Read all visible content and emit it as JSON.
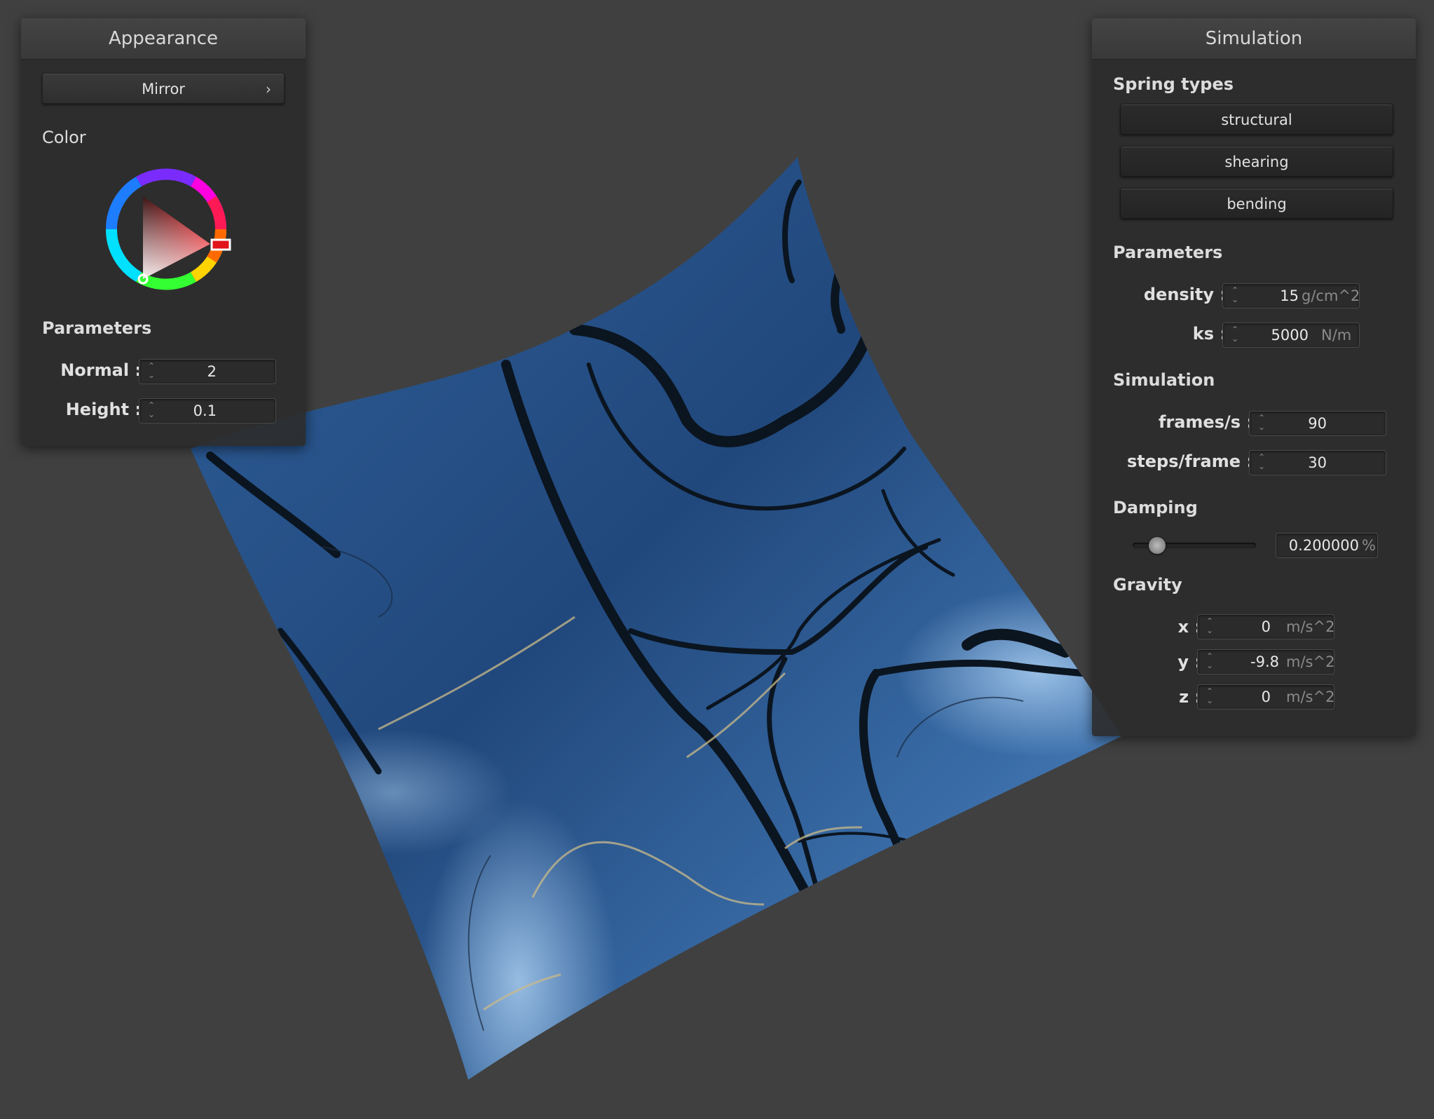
{
  "appearance": {
    "title": "Appearance",
    "shader_button": "Mirror",
    "color_label": "Color",
    "parameters_label": "Parameters",
    "normal_label": "Normal :",
    "normal_value": "2",
    "height_label": "Height :",
    "height_value": "0.1"
  },
  "simulation": {
    "title": "Simulation",
    "spring_types_label": "Spring types",
    "spring_buttons": [
      "structural",
      "shearing",
      "bending"
    ],
    "parameters_label": "Parameters",
    "density_label": "density :",
    "density_value": "15",
    "density_unit": "g/cm^2",
    "ks_label": "ks :",
    "ks_value": "5000",
    "ks_unit": "N/m",
    "simulation_label": "Simulation",
    "fps_label": "frames/s :",
    "fps_value": "90",
    "steps_label": "steps/frame :",
    "steps_value": "30",
    "damping_label": "Damping",
    "damping_value": "0.200000",
    "damping_unit": "%",
    "damping_fraction": 0.2,
    "gravity_label": "Gravity",
    "gx_label": "x :",
    "gx_value": "0",
    "gy_label": "y :",
    "gy_value": "-9.8",
    "gz_label": "z :",
    "gz_value": "0",
    "gravity_unit": "m/s^2"
  },
  "colors": {
    "background": "#404040",
    "cloth": "#2c568e",
    "selected_color": "#e0141a"
  },
  "icons": {
    "spin_arrows": "updown-chevron-icon",
    "submenu": "chevron-right-icon"
  }
}
